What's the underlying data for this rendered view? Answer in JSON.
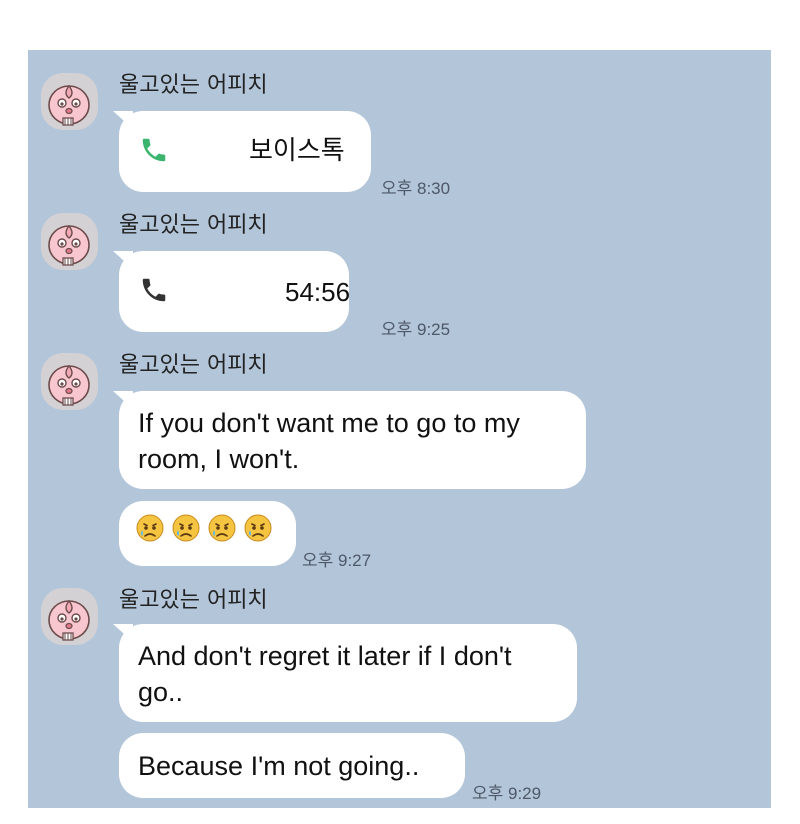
{
  "chat": {
    "sender_name": "울고있는 어피치",
    "background": "#b3c5d9",
    "messages": {
      "call1": {
        "label": "보이스톡",
        "icon": "phone-icon",
        "icon_color": "#3bb46e",
        "time": "오후 8:30"
      },
      "call2": {
        "label": "54:56",
        "icon": "phone-icon",
        "icon_color": "#333333",
        "time": "오후 9:25"
      },
      "msg1": {
        "text": "If you don't want me to go to my room, I won't."
      },
      "emoji_msg": {
        "emojis": [
          "crying-face",
          "crying-face",
          "crying-face",
          "crying-face"
        ],
        "time": "오후 9:27"
      },
      "msg2": {
        "text": "And don't regret it later if I don't go.."
      },
      "msg3": {
        "text": "Because I'm not going..",
        "time": "오후 9:29"
      }
    }
  }
}
